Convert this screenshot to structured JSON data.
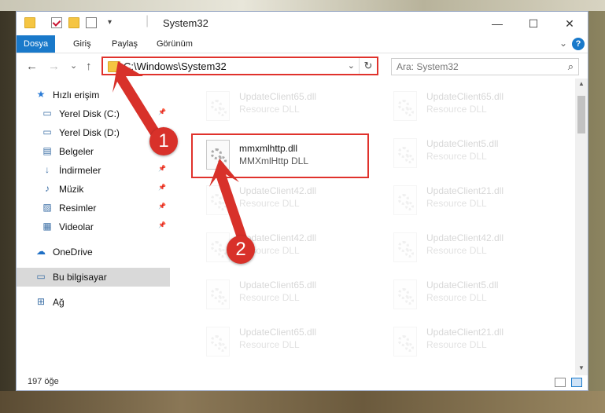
{
  "window": {
    "title": "System32",
    "minimize_glyph": "—",
    "maximize_glyph": "☐",
    "close_glyph": "✕"
  },
  "ribbon": {
    "tabs": [
      "Dosya",
      "Giriş",
      "Paylaş",
      "Görünüm"
    ],
    "expand_glyph": "⌄",
    "help_glyph": "?"
  },
  "navbar": {
    "back_glyph": "←",
    "forward_glyph": "→",
    "recent_glyph": "⌄",
    "up_glyph": "↑",
    "address": "C:\\Windows\\System32",
    "address_dropdown_glyph": "⌄",
    "refresh_glyph": "↻",
    "search_placeholder": "Ara: System32",
    "search_glyph": "⌕"
  },
  "sidebar": {
    "pin_glyph": "📌",
    "items": [
      {
        "label": "Hızlı erişim",
        "icon": "star-icon",
        "glyph": "★",
        "pinned": false
      },
      {
        "label": "Yerel Disk (C:)",
        "icon": "drive-icon",
        "glyph": "▭",
        "pinned": true
      },
      {
        "label": "Yerel Disk (D:)",
        "icon": "drive-icon",
        "glyph": "▭",
        "pinned": true
      },
      {
        "label": "Belgeler",
        "icon": "documents-icon",
        "glyph": "▤",
        "pinned": true
      },
      {
        "label": "İndirmeler",
        "icon": "download-icon",
        "glyph": "↓",
        "pinned": true
      },
      {
        "label": "Müzik",
        "icon": "music-icon",
        "glyph": "♪",
        "pinned": true
      },
      {
        "label": "Resimler",
        "icon": "pictures-icon",
        "glyph": "▨",
        "pinned": true
      },
      {
        "label": "Videolar",
        "icon": "videos-icon",
        "glyph": "▦",
        "pinned": true
      },
      {
        "label": "OneDrive",
        "icon": "cloud-icon",
        "glyph": "☁",
        "pinned": false
      },
      {
        "label": "Bu bilgisayar",
        "icon": "computer-icon",
        "glyph": "▭",
        "pinned": false,
        "selected": true
      },
      {
        "label": "Ağ",
        "icon": "network-icon",
        "glyph": "⊞",
        "pinned": false
      }
    ]
  },
  "files": [
    {
      "name": "UpdateClient65.dll",
      "desc": "Resource DLL",
      "ghost": true
    },
    {
      "name": "UpdateClient65.dll",
      "desc": "Resource DLL",
      "ghost": true
    },
    {
      "name": "mmxmlhttp.dll",
      "desc": "MMXmlHttp DLL",
      "ghost": false
    },
    {
      "name": "UpdateClient5.dll",
      "desc": "Resource DLL",
      "ghost": true
    },
    {
      "name": "UpdateClient42.dll",
      "desc": "Resource DLL",
      "ghost": true
    },
    {
      "name": "UpdateClient21.dll",
      "desc": "Resource DLL",
      "ghost": true
    },
    {
      "name": "UpdateClient42.dll",
      "desc": "Resource DLL",
      "ghost": true
    },
    {
      "name": "UpdateClient42.dll",
      "desc": "Resource DLL",
      "ghost": true
    },
    {
      "name": "UpdateClient65.dll",
      "desc": "Resource DLL",
      "ghost": true
    },
    {
      "name": "UpdateClient5.dll",
      "desc": "Resource DLL",
      "ghost": true
    },
    {
      "name": "UpdateClient65.dll",
      "desc": "Resource DLL",
      "ghost": true
    },
    {
      "name": "UpdateClient21.dll",
      "desc": "Resource DLL",
      "ghost": true
    }
  ],
  "scrollbar": {
    "up_glyph": "▲",
    "down_glyph": "▼"
  },
  "status": {
    "count": "197 öğe"
  },
  "callouts": [
    "1",
    "2"
  ],
  "colors": {
    "accent": "#1979ca",
    "highlight": "#e0322c",
    "callout": "#d8312a"
  }
}
